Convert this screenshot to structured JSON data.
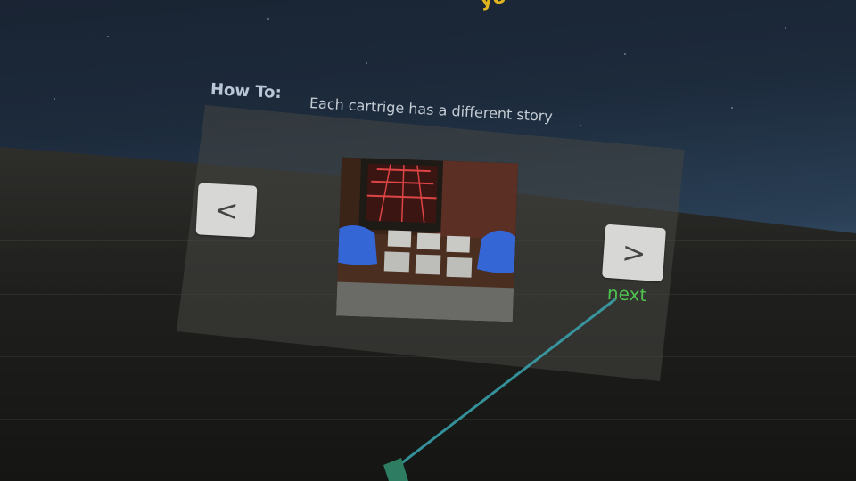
{
  "scene": {
    "top_partial_text": "yo"
  },
  "instructions": {
    "label": "How To:",
    "description": "Each cartrige has a different story"
  },
  "navigation": {
    "prev_symbol": "<",
    "next_symbol": ">",
    "next_label": "next"
  },
  "colors": {
    "accent_yellow": "#e0b41e",
    "next_green": "#4fc24f",
    "laser_cyan": "#3aa6b0"
  },
  "icons": {
    "prev": "chevron-left-icon",
    "next": "chevron-right-icon"
  }
}
